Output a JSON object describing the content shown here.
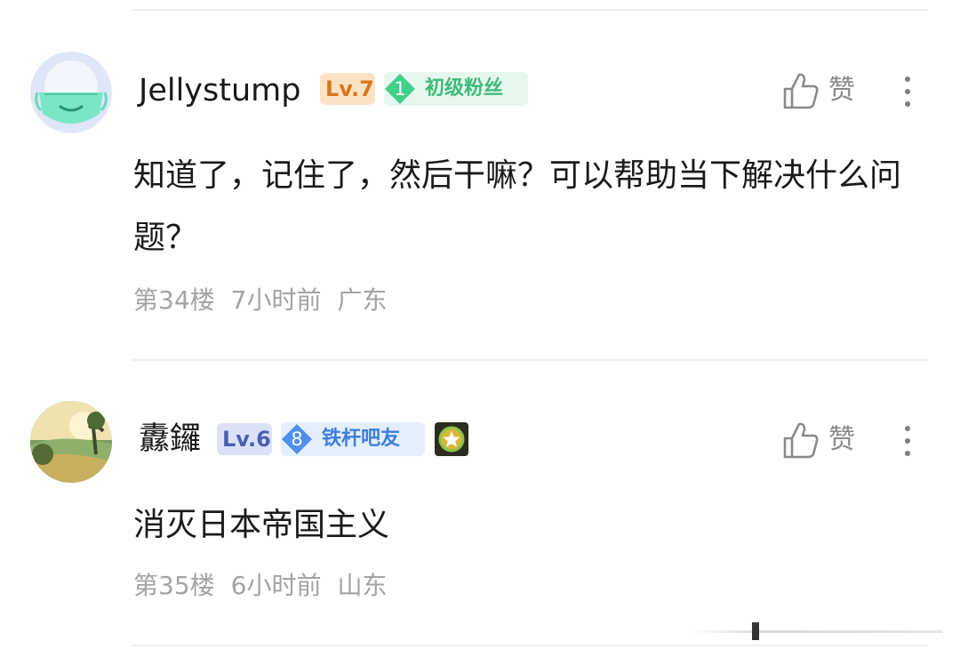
{
  "comments": [
    {
      "username": "Jellystump",
      "level": "Lv.7",
      "fan_level": "1",
      "fan_title": "初级粉丝",
      "like_label": "赞",
      "content": "知道了，记住了，然后干嘛？可以帮助当下解决什么问题？",
      "floor": "第34楼",
      "time": "7小时前",
      "location": "广东"
    },
    {
      "username": "纛鑼",
      "level": "Lv.6",
      "fan_level": "8",
      "fan_title": "铁杆吧友",
      "like_label": "赞",
      "content": "消灭日本帝国主义",
      "floor": "第35楼",
      "time": "6小时前",
      "location": "山东"
    }
  ],
  "colors": {
    "lv7_bg": "#fde3c6",
    "lv7_text": "#d9771f",
    "lv6_bg": "#dbe2f8",
    "lv6_text": "#4a5fb0",
    "fan1_bg": "#e6f7ee",
    "fan1_text": "#3fbb7a",
    "fan8_bg": "#e4eefd",
    "fan8_text": "#3d7fe0"
  },
  "icons": [
    "mask-avatar-icon",
    "landscape-avatar-icon",
    "thumbs-up-icon",
    "more-vertical-icon",
    "star-medal-icon"
  ]
}
